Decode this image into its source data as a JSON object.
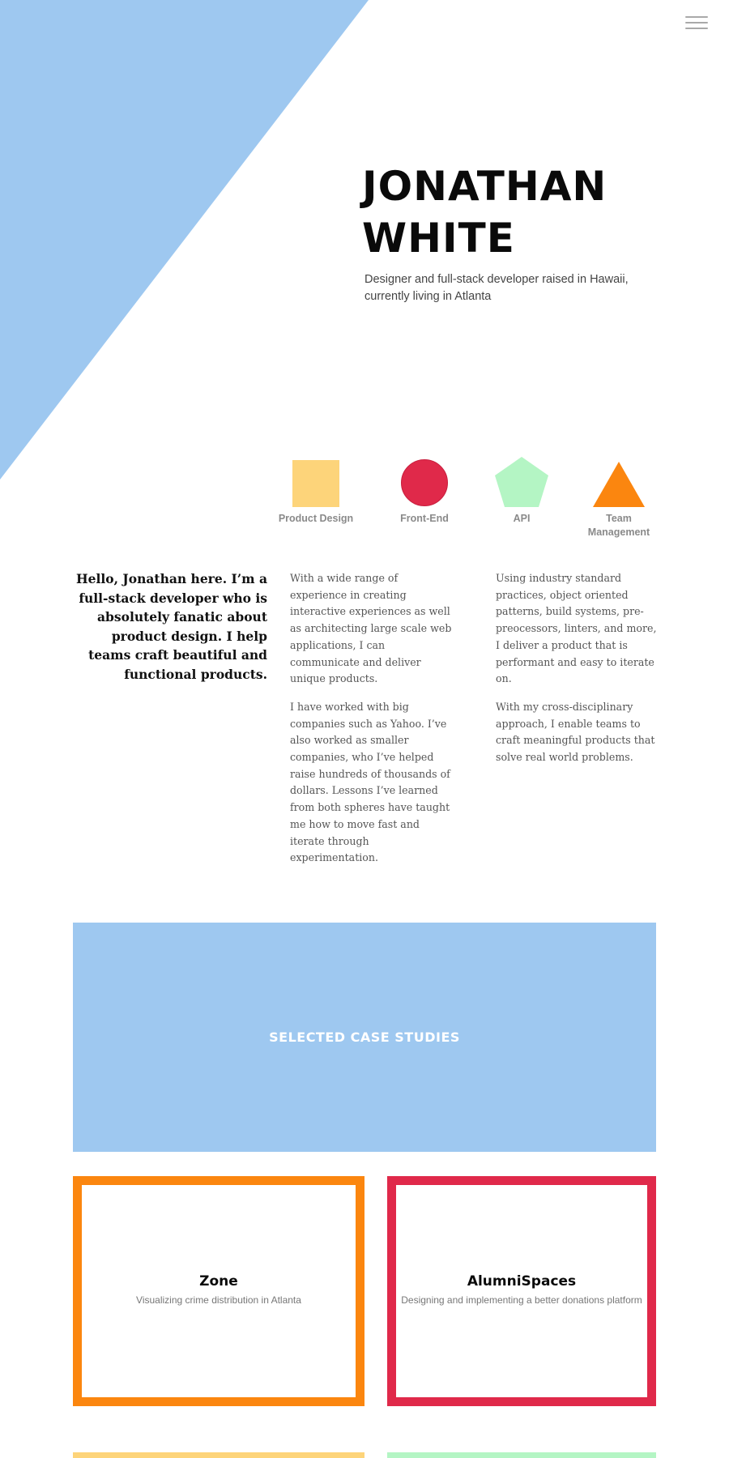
{
  "colors": {
    "hero_blue": "#9ec8f0",
    "yellow": "#fdd47a",
    "red": "#e0294a",
    "green": "#b4f5c4",
    "orange": "#fb860f",
    "menu_gray": "#a9a9a9"
  },
  "nav": {
    "menu_icon": "hamburger-menu-icon"
  },
  "hero": {
    "name_line1": "JONATHAN",
    "name_line2": "WHITE",
    "subtitle": "Designer and full-stack developer raised in Hawaii, currently living in Atlanta"
  },
  "skills": [
    {
      "label": "Product Design",
      "icon": "square-icon",
      "color": "#fdd47a"
    },
    {
      "label": "Front-End",
      "icon": "circle-icon",
      "color": "#e0294a"
    },
    {
      "label": "API",
      "icon": "pentagon-icon",
      "color": "#b4f5c4"
    },
    {
      "label": "Team Management",
      "icon": "triangle-icon",
      "color": "#fb860f"
    }
  ],
  "about": {
    "lead": "Hello, Jonathan here. I’m a full-stack developer who is absolutely fanatic about product design. I help teams craft beautiful and functional products.",
    "col1_p1": "With a wide range of experience in creating interactive experiences as well as architecting large scale web applications, I can communicate and deliver unique products.",
    "col1_p2": "I have worked with big companies such as Yahoo. I’ve also worked as smaller companies, who I’ve helped raise hundreds of thousands of dollars. Lessons I’ve learned from both spheres have taught me how to move fast and iterate through experimentation.",
    "col2_p1": "Using industry standard practices, object oriented patterns, build systems, pre-preocessors, linters, and more, I deliver a product that is performant and easy to iterate on.",
    "col2_p2": "With my cross-disciplinary approach, I enable teams to craft meaningful products that solve real world problems."
  },
  "case_studies": {
    "heading": "SELECTED CASE STUDIES",
    "items": [
      {
        "title": "Zone",
        "description": "Visualizing crime distribution in Atlanta",
        "color": "#fb860f"
      },
      {
        "title": "AlumniSpaces",
        "description": "Designing and implementing a better donations platform",
        "color": "#e0294a"
      }
    ],
    "next_row_colors": [
      "#fdd47a",
      "#b4f5c4"
    ]
  }
}
